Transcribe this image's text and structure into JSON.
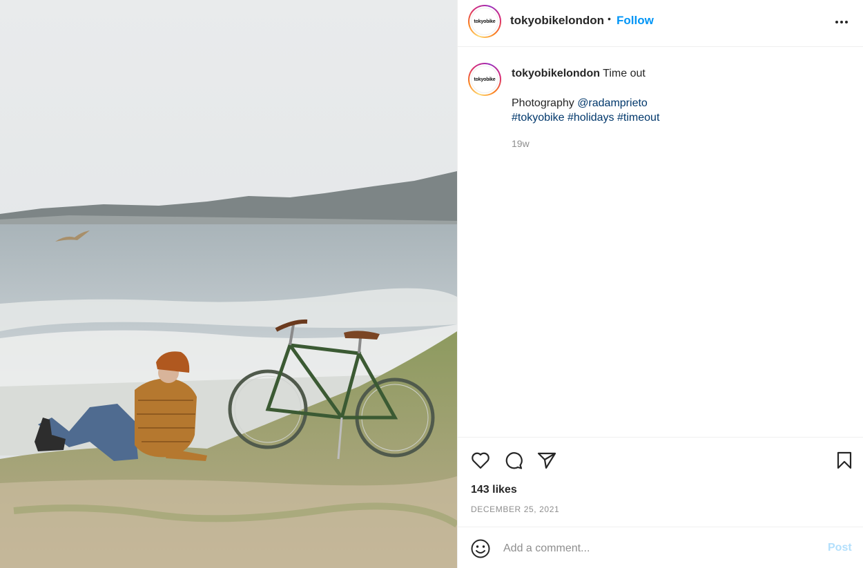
{
  "post": {
    "photo_alt": "",
    "account": {
      "username": "tokyobikelondon",
      "avatar_text": "tokyobike",
      "follow_label": "Follow",
      "separator": "•"
    },
    "caption": {
      "username": "tokyobikelondon",
      "text": "Time out",
      "credit_prefix": "Photography",
      "mention": "@radamprieto",
      "hashtags": [
        "#tokyobike",
        "#holidays",
        "#timeout"
      ],
      "age": "19w"
    },
    "engagement": {
      "likes": "143 likes",
      "date": "DECEMBER 25, 2021"
    },
    "comment_box": {
      "placeholder": "Add a comment...",
      "post_label": "Post"
    },
    "icons": {
      "more": "more-options-icon",
      "like": "heart-icon",
      "comment": "comment-icon",
      "share": "send-icon",
      "save": "bookmark-icon",
      "emoji": "emoji-icon"
    },
    "colors": {
      "follow": "#0095f6",
      "link": "#00376b",
      "muted": "#8e8e8e",
      "post_disabled": "#b2dffc",
      "border": "#efefef"
    }
  }
}
